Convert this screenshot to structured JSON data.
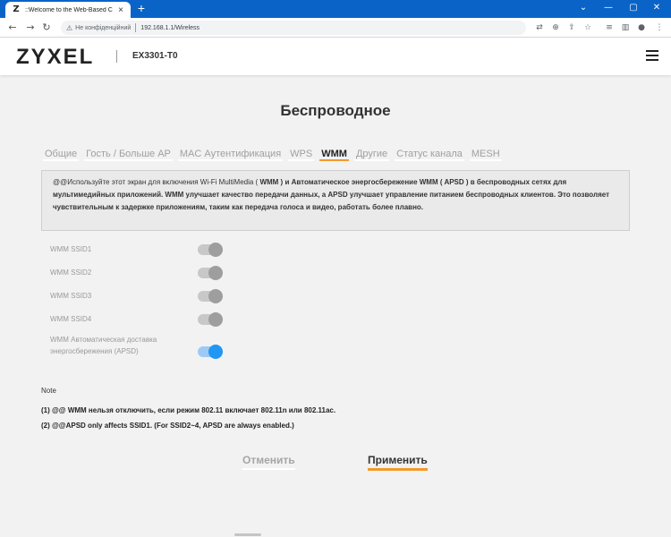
{
  "browser": {
    "tab_favicon": "Z",
    "tab_title": "::Welcome to the Web-Based Co",
    "tab_close": "×",
    "new_tab": "+",
    "security_label": "Не конфіденційний",
    "url": "192.168.1.1/Wireless",
    "icons": [
      "back-arrow-icon",
      "forward-arrow-icon",
      "reload-icon",
      "translate-icon",
      "zoom-icon",
      "share-icon",
      "star-icon",
      "reading-list-icon",
      "sidebar-icon",
      "profile-icon",
      "menu-dots-icon"
    ]
  },
  "header": {
    "logo": "ZYXEL",
    "model": "EX3301-T0"
  },
  "page": {
    "title": "Беспроводное",
    "tabs": [
      {
        "label": "Общие"
      },
      {
        "label": "Гость / Больше AP"
      },
      {
        "label": "MAC Аутентификация"
      },
      {
        "label": "WPS"
      },
      {
        "label": "WMM",
        "active": true
      },
      {
        "label": "Другие"
      },
      {
        "label": "Статус канала"
      },
      {
        "label": "MESH"
      }
    ],
    "info_text": {
      "p1": "@@Используйте этот экран для включения Wi-Fi MultiMedia ( ",
      "wmm": "WMM",
      "p2": " ) и Автоматическое энергосбережение WMM ( APSD ) в беспроводных сетях для мультимедийных приложений. WMM улучшает качество передачи данных, а APSD улучшает управление питанием беспроводных клиентов. Это позволяет чувствительным к задержке приложениям, таким как передача голоса и видео, работать более плавно."
    },
    "settings": [
      {
        "label": "WMM SSID1",
        "on": false
      },
      {
        "label": "WMM SSID2",
        "on": false
      },
      {
        "label": "WMM SSID3",
        "on": false
      },
      {
        "label": "WMM SSID4",
        "on": false
      },
      {
        "label": "WMM Автоматическая доставка энергосбережения (APSD)",
        "on": true
      }
    ],
    "note_title": "Note",
    "notes": [
      "(1) @@ WMM нельзя отключить, если режим 802.11 включает 802.11n или 802.11ac.",
      "(2) @@APSD only affects SSID1. (For SSID2~4, APSD are always enabled.)"
    ],
    "cancel_label": "Отменить",
    "apply_label": "Применить"
  },
  "colors": {
    "accent": "#f39a2a",
    "toggle_on": "#2196f3",
    "browser_bar": "#0a64c8"
  }
}
